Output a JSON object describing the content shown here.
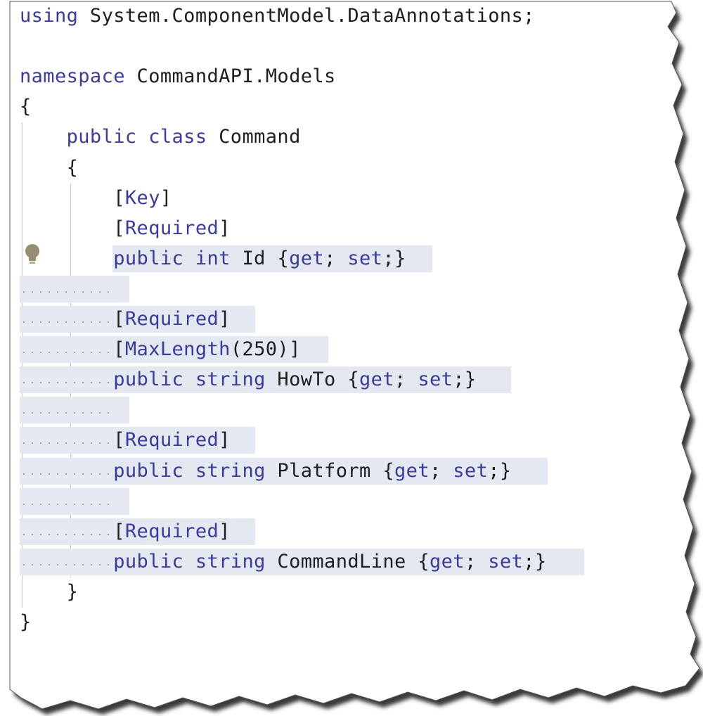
{
  "code_lines": [
    [
      {
        "t": "using",
        "c": "kw"
      },
      {
        "t": " System.ComponentModel.DataAnnotations;",
        "c": "id"
      }
    ],
    [],
    [
      {
        "t": "namespace",
        "c": "kw"
      },
      {
        "t": " CommandAPI.Models",
        "c": "id"
      }
    ],
    [
      {
        "t": "{",
        "c": "pn"
      }
    ],
    [
      {
        "t": "    "
      },
      {
        "t": "public",
        "c": "kw"
      },
      {
        "t": " "
      },
      {
        "t": "class",
        "c": "kw"
      },
      {
        "t": " Command",
        "c": "id"
      }
    ],
    [
      {
        "t": "    {",
        "c": "pn"
      }
    ],
    [
      {
        "t": "        "
      },
      {
        "t": "[",
        "c": "pn"
      },
      {
        "t": "Key",
        "c": "at"
      },
      {
        "t": "]",
        "c": "pn"
      }
    ],
    [
      {
        "t": "        "
      },
      {
        "t": "[",
        "c": "pn"
      },
      {
        "t": "Required",
        "c": "at"
      },
      {
        "t": "]",
        "c": "pn"
      }
    ],
    [
      {
        "t": "        "
      },
      {
        "t": "public",
        "c": "kw"
      },
      {
        "t": " "
      },
      {
        "t": "int",
        "c": "kw"
      },
      {
        "t": " Id ",
        "c": "id"
      },
      {
        "t": "{",
        "c": "pn"
      },
      {
        "t": "get",
        "c": "kw"
      },
      {
        "t": "; ",
        "c": "pn"
      },
      {
        "t": "set",
        "c": "kw"
      },
      {
        "t": ";}",
        "c": "pn"
      }
    ],
    [],
    [
      {
        "t": "        "
      },
      {
        "t": "[",
        "c": "pn"
      },
      {
        "t": "Required",
        "c": "at"
      },
      {
        "t": "]",
        "c": "pn"
      }
    ],
    [
      {
        "t": "        "
      },
      {
        "t": "[",
        "c": "pn"
      },
      {
        "t": "MaxLength",
        "c": "at"
      },
      {
        "t": "(250)]",
        "c": "pn"
      }
    ],
    [
      {
        "t": "        "
      },
      {
        "t": "public",
        "c": "kw"
      },
      {
        "t": " "
      },
      {
        "t": "string",
        "c": "kw"
      },
      {
        "t": " HowTo ",
        "c": "id"
      },
      {
        "t": "{",
        "c": "pn"
      },
      {
        "t": "get",
        "c": "kw"
      },
      {
        "t": "; ",
        "c": "pn"
      },
      {
        "t": "set",
        "c": "kw"
      },
      {
        "t": ";}",
        "c": "pn"
      }
    ],
    [],
    [
      {
        "t": "        "
      },
      {
        "t": "[",
        "c": "pn"
      },
      {
        "t": "Required",
        "c": "at"
      },
      {
        "t": "]",
        "c": "pn"
      }
    ],
    [
      {
        "t": "        "
      },
      {
        "t": "public",
        "c": "kw"
      },
      {
        "t": " "
      },
      {
        "t": "string",
        "c": "kw"
      },
      {
        "t": " Platform ",
        "c": "id"
      },
      {
        "t": "{",
        "c": "pn"
      },
      {
        "t": "get",
        "c": "kw"
      },
      {
        "t": "; ",
        "c": "pn"
      },
      {
        "t": "set",
        "c": "kw"
      },
      {
        "t": ";}",
        "c": "pn"
      }
    ],
    [],
    [
      {
        "t": "        "
      },
      {
        "t": "[",
        "c": "pn"
      },
      {
        "t": "Required",
        "c": "at"
      },
      {
        "t": "]",
        "c": "pn"
      }
    ],
    [
      {
        "t": "        "
      },
      {
        "t": "public",
        "c": "kw"
      },
      {
        "t": " "
      },
      {
        "t": "string",
        "c": "kw"
      },
      {
        "t": " CommandLine ",
        "c": "id"
      },
      {
        "t": "{",
        "c": "pn"
      },
      {
        "t": "get",
        "c": "kw"
      },
      {
        "t": "; ",
        "c": "pn"
      },
      {
        "t": "set",
        "c": "kw"
      },
      {
        "t": ";}",
        "c": "pn"
      }
    ],
    [
      {
        "t": "    }",
        "c": "pn"
      }
    ],
    [
      {
        "t": "}",
        "c": "pn"
      }
    ]
  ],
  "selection": {
    "first_line": 8,
    "last_line": 18
  },
  "lightbulb_line": 8,
  "colors": {
    "keyword": "#3b3b9a",
    "identifier": "#1e1e1e",
    "selection": "#e3e8f1",
    "frame_shadow": "#3a3a3a"
  }
}
